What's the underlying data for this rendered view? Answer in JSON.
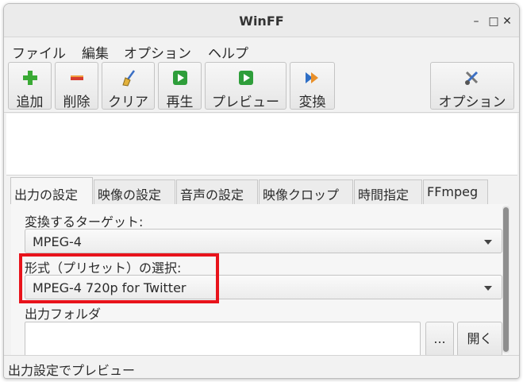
{
  "window": {
    "title": "WinFF"
  },
  "menu": [
    "ファイル",
    "編集",
    "オプション",
    "ヘルプ"
  ],
  "toolbar": {
    "add": "追加",
    "delete": "削除",
    "clear": "クリア",
    "play": "再生",
    "preview": "プレビュー",
    "convert": "変換",
    "options": "オプション"
  },
  "tabs": [
    "出力の設定",
    "映像の設定",
    "音声の設定",
    "映像クロップ",
    "時間指定",
    "FFmpeg"
  ],
  "output_settings": {
    "target_label": "変換するターゲット:",
    "target_value": "MPEG-4",
    "preset_label": "形式（プリセット）の選択:",
    "preset_value": "MPEG-4 720p for Twitter",
    "folder_label": "出力フォルダ",
    "folder_value": "",
    "browse_label": "...",
    "open_label": "開く"
  },
  "status": "出力設定でプレビュー",
  "colors": {
    "highlight": "#e8131b",
    "add_icon": "#3aaa35",
    "delete_icon": "#d63c2f",
    "play_icon": "#2e9e3a"
  },
  "icons": {
    "add": "plus-icon",
    "delete": "minus-icon",
    "clear": "broom-icon",
    "play": "play-icon",
    "preview": "play-icon",
    "convert": "double-arrow-icon",
    "options": "tools-icon"
  }
}
